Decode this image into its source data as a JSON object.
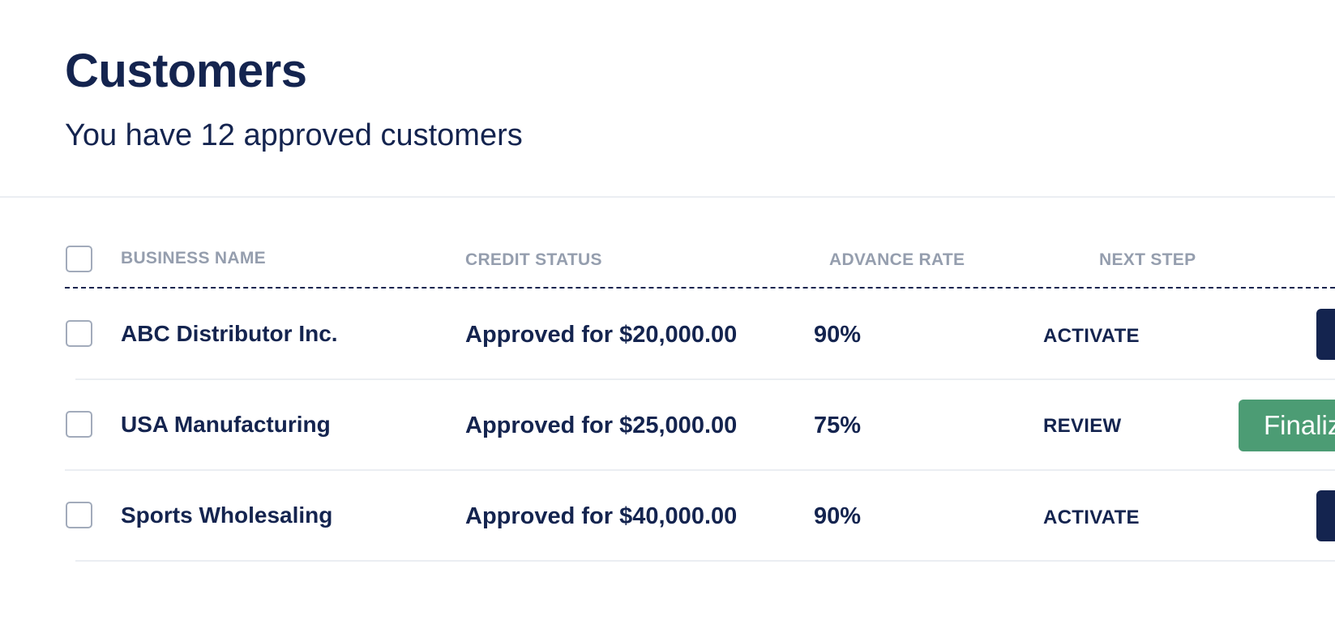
{
  "page": {
    "title": "Customers",
    "subtitle": "You have 12 approved customers"
  },
  "table": {
    "columns": [
      {
        "label": "BUSINESS NAME"
      },
      {
        "label": "CREDIT STATUS"
      },
      {
        "label": "ADVANCE RATE"
      },
      {
        "label": "NEXT STEP"
      }
    ],
    "rows": [
      {
        "business_name": "ABC Distributor Inc.",
        "credit_status": "Approved for $20,000.00",
        "advance_rate": "90%",
        "next_step": "ACTIVATE",
        "action": {
          "label": "",
          "style": "dark"
        }
      },
      {
        "business_name": "USA Manufacturing",
        "credit_status": "Approved for $25,000.00",
        "advance_rate": "75%",
        "next_step": "REVIEW",
        "action": {
          "label": "Finalize",
          "style": "green"
        }
      },
      {
        "business_name": "Sports Wholesaling",
        "credit_status": "Approved for $40,000.00",
        "advance_rate": "90%",
        "next_step": "ACTIVATE",
        "action": {
          "label": "",
          "style": "dark"
        }
      }
    ]
  },
  "colors": {
    "navy": "#14244f",
    "header_gray": "#959eae",
    "green_button": "#4c9c74",
    "divider": "#ebeef2"
  }
}
